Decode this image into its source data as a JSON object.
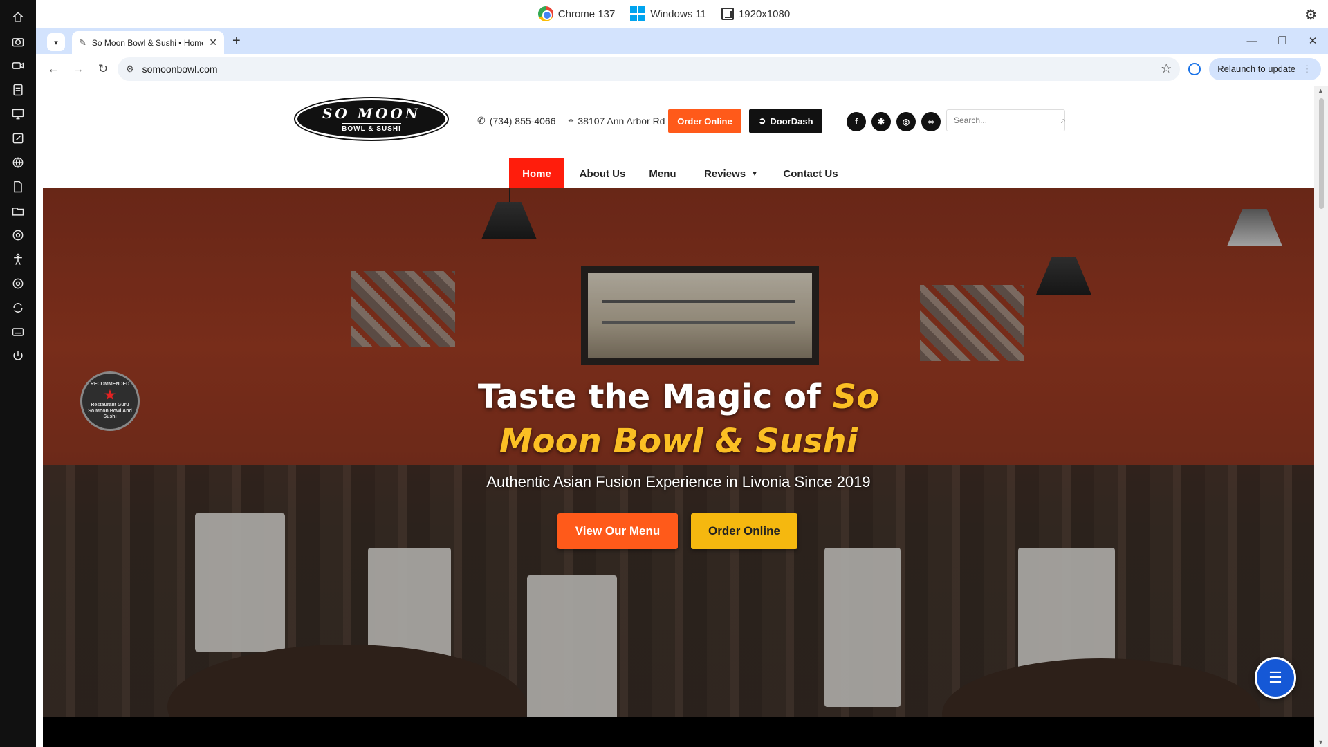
{
  "system_bar": {
    "browser": "Chrome 137",
    "os": "Windows 11",
    "resolution": "1920x1080"
  },
  "dock": {
    "icons": [
      "home-icon",
      "camera-icon",
      "video-icon",
      "file-icon",
      "monitor-icon",
      "edit-icon",
      "globe-icon",
      "document-icon",
      "folder-icon",
      "chrome-icon",
      "accessibility-icon",
      "settings-icon",
      "sync-icon",
      "keyboard-icon",
      "power-icon"
    ]
  },
  "browser": {
    "tab_title": "So Moon Bowl & Sushi • Home",
    "url": "somoonbowl.com",
    "relaunch_label": "Relaunch to update"
  },
  "site": {
    "logo": {
      "line1": "SO MOON",
      "line2": "BOWL & SUSHI"
    },
    "phone": "(734) 855-4066",
    "address": "38107 Ann Arbor Rd",
    "order_online": "Order Online",
    "doordash": "DoorDash",
    "search_placeholder": "Search...",
    "socials": [
      "facebook-icon",
      "yelp-icon",
      "instagram-icon",
      "tripadvisor-icon"
    ],
    "nav": [
      {
        "label": "Home",
        "active": true
      },
      {
        "label": "About Us"
      },
      {
        "label": "Menu"
      },
      {
        "label": "Reviews"
      },
      {
        "label": "Contact Us"
      }
    ],
    "hero": {
      "title_line1_white": "Taste the Magic of ",
      "title_line1_accent": "So",
      "title_line2_accent": "Moon Bowl & Sushi",
      "subtitle": "Authentic Asian Fusion Experience in Livonia Since 2019",
      "btn_menu": "View Our Menu",
      "btn_order": "Order Online"
    },
    "badge": {
      "top": "RECOMMENDED",
      "middle": "Restaurant Guru",
      "bottom": "So Moon Bowl And Sushi"
    }
  },
  "colors": {
    "order_orange": "#ff5a1a",
    "nav_active_red": "#ff1d0c",
    "accent_yellow": "#fbbf24",
    "accessibility_blue": "#1558d6"
  }
}
